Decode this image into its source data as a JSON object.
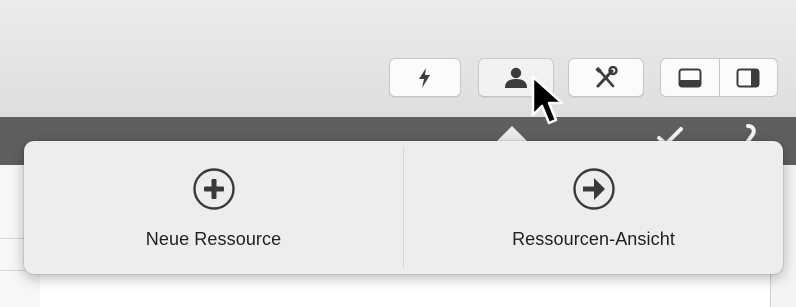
{
  "toolbar": {
    "buttons": [
      {
        "name": "lightning-button",
        "icon": "lightning-icon"
      },
      {
        "name": "person-button",
        "icon": "person-icon"
      },
      {
        "name": "tools-button",
        "icon": "wrench-screwdriver-icon"
      }
    ],
    "view_segments": [
      {
        "name": "bottom-panel-toggle",
        "icon": "bottom-panel-icon"
      },
      {
        "name": "side-panel-toggle",
        "icon": "right-panel-icon"
      }
    ]
  },
  "popover": {
    "actions": [
      {
        "label": "Neue Ressource",
        "icon": "plus-circle-icon"
      },
      {
        "label": "Ressourcen-Ansicht",
        "icon": "arrow-right-circle-icon"
      }
    ]
  },
  "colors": {
    "toolbar_bg": "#e4e4e4",
    "dark_bar": "#5f5f5f",
    "popover_bg": "#ededed",
    "icon": "#3c3c3c"
  }
}
